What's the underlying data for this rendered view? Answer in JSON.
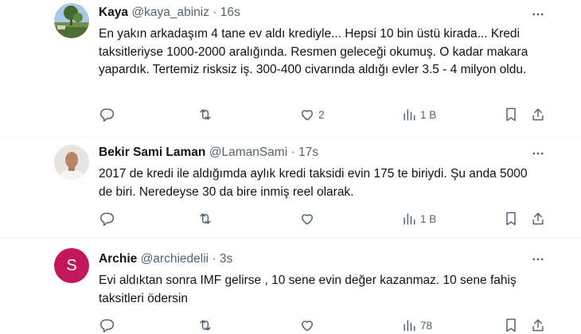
{
  "tweets": [
    {
      "name": "Kaya",
      "handle": "@kaya_abiniz",
      "dot": "·",
      "time": "16s",
      "text": "En yakın arkadaşım 4 tane ev aldı krediyle... Hepsi 10 bin üstü kirada... Kredi taksitleriyse 1000-2000 aralığında. Resmen geleceği okumuş. O kadar makara yapardık. Tertemiz risksiz iş. 300-400 civarında aldığı evler 3.5 - 4 milyon oldu.",
      "replies": "",
      "retweets": "",
      "likes": "2",
      "views": "1 B"
    },
    {
      "name": "Bekir Sami Laman",
      "handle": "@LamanSami",
      "dot": "·",
      "time": "17s",
      "text": "2017 de kredi ile aldığımda aylık kredi taksidi evin 175 te biriydi. Şu anda 5000 de biri. Neredeyse 30 da bire inmiş reel olarak.",
      "replies": "",
      "retweets": "",
      "likes": "",
      "views": "1 B"
    },
    {
      "name": "Archie",
      "handle": "@archiedelii",
      "dot": "·",
      "time": "3s",
      "avatar_letter": "S",
      "text": "Evi aldıktan sonra IMF gelirse , 10 sene evin değer kazanmaz. 10 sene fahiş taksitleri ödersin",
      "replies": "",
      "retweets": "",
      "likes": "",
      "views": "78"
    }
  ],
  "icons": {
    "more": "more-icon",
    "reply": "reply-icon",
    "retweet": "retweet-icon",
    "like": "heart-icon",
    "views": "views-icon",
    "bookmark": "bookmark-icon",
    "share": "share-icon"
  },
  "colors": {
    "text": "#0f1419",
    "secondary": "#536471",
    "divider": "#eff3f4",
    "avatar_letter_bg": "#c2185b"
  }
}
